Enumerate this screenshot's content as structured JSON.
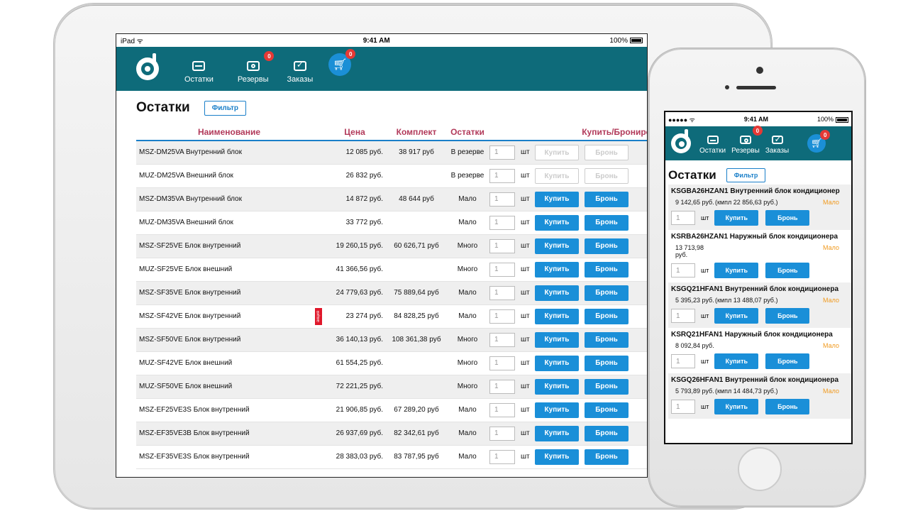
{
  "ipad": {
    "status": {
      "left": "iPad ᯤ",
      "time": "9:41 AM",
      "battery": "100%"
    },
    "nav": {
      "items": [
        {
          "label": "Остатки",
          "badge": ""
        },
        {
          "label": "Резервы",
          "badge": "0"
        },
        {
          "label": "Заказы",
          "badge": ""
        }
      ],
      "cart_badge": "0"
    },
    "title": "Остатки",
    "filter_label": "Фильтр",
    "table": {
      "headers": [
        "Наименование",
        "Цена",
        "Комплект",
        "Остатки",
        "",
        "Купить/Бронирo"
      ],
      "unit": "шт",
      "qty_default": "1",
      "buy_label": "Купить",
      "reserve_label": "Бронь",
      "promo_label": "акция",
      "rows": [
        {
          "name": "MSZ-DM25VA Внутренний блок",
          "price": "12 085 руб.",
          "kit": "38 917 руб",
          "status": "В резерве",
          "status_type": "reserve",
          "disabled": true,
          "promo": false
        },
        {
          "name": "MUZ-DM25VA Внешний блок",
          "price": "26 832 руб.",
          "kit": "",
          "status": "В резерве",
          "status_type": "reserve",
          "disabled": true,
          "promo": false
        },
        {
          "name": "MSZ-DM35VA Внутренний блок",
          "price": "14 872 руб.",
          "kit": "48 644 руб",
          "status": "Мало",
          "status_type": "low",
          "disabled": false,
          "promo": false
        },
        {
          "name": "MUZ-DM35VA Внешний блок",
          "price": "33 772 руб.",
          "kit": "",
          "status": "Мало",
          "status_type": "low",
          "disabled": false,
          "promo": false
        },
        {
          "name": "MSZ-SF25VE Блок внутренний",
          "price": "19 260,15 руб.",
          "kit": "60 626,71 руб",
          "status": "Много",
          "status_type": "many",
          "disabled": false,
          "promo": false
        },
        {
          "name": "MUZ-SF25VE Блок внешний",
          "price": "41 366,56 руб.",
          "kit": "",
          "status": "Много",
          "status_type": "many",
          "disabled": false,
          "promo": false
        },
        {
          "name": "MSZ-SF35VE Блок внутренний",
          "price": "24 779,63 руб.",
          "kit": "75 889,64 руб",
          "status": "Мало",
          "status_type": "low",
          "disabled": false,
          "promo": false
        },
        {
          "name": "MSZ-SF42VE Блок внутренний",
          "price": "23 274 руб.",
          "kit": "84 828,25 руб",
          "status": "Мало",
          "status_type": "low",
          "disabled": false,
          "promo": true
        },
        {
          "name": "MSZ-SF50VE Блок внутренний",
          "price": "36 140,13 руб.",
          "kit": "108 361,38 руб",
          "status": "Много",
          "status_type": "many",
          "disabled": false,
          "promo": false
        },
        {
          "name": "MUZ-SF42VE Блок внешний",
          "price": "61 554,25 руб.",
          "kit": "",
          "status": "Много",
          "status_type": "many",
          "disabled": false,
          "promo": false
        },
        {
          "name": "MUZ-SF50VE Блок внешний",
          "price": "72 221,25 руб.",
          "kit": "",
          "status": "Много",
          "status_type": "many",
          "disabled": false,
          "promo": false
        },
        {
          "name": "MSZ-EF25VE3S Блок внутренний",
          "price": "21 906,85 руб.",
          "kit": "67 289,20 руб",
          "status": "Мало",
          "status_type": "low",
          "disabled": false,
          "promo": false
        },
        {
          "name": "MSZ-EF35VE3B Блок внутренний",
          "price": "26 937,69 руб.",
          "kit": "82 342,61 руб",
          "status": "Мало",
          "status_type": "low",
          "disabled": false,
          "promo": false
        },
        {
          "name": "MSZ-EF35VE3S Блок внутренний",
          "price": "28 383,03 руб.",
          "kit": "83 787,95 руб",
          "status": "Мало",
          "status_type": "low",
          "disabled": false,
          "promo": false
        }
      ]
    }
  },
  "iphone": {
    "status": {
      "left": "●●●●● ᯤ",
      "time": "9:41 AM",
      "battery": "100%"
    },
    "nav": {
      "items": [
        {
          "label": "Остатки",
          "badge": ""
        },
        {
          "label": "Резервы",
          "badge": "0"
        },
        {
          "label": "Заказы",
          "badge": ""
        }
      ],
      "cart_badge": "0"
    },
    "title": "Остатки",
    "filter_label": "Фильтр",
    "unit": "шт",
    "qty_default": "1",
    "buy_label": "Купить",
    "reserve_label": "Бронь",
    "items": [
      {
        "name": "KSGBA26HZAN1 Внутренний блок кондиционер",
        "price": "9 142,65 руб.",
        "kit": "(кмпл 22 856,63 руб.)",
        "status": "Мало"
      },
      {
        "name": "KSRBA26HZAN1 Наружный блок кондиционера",
        "price": "13 713,98 руб.",
        "kit": "",
        "status": "Мало"
      },
      {
        "name": "KSGQ21HFAN1 Внутренний блок кондиционера",
        "price": "5 395,23 руб.",
        "kit": "(кмпл 13 488,07 руб.)",
        "status": "Мало"
      },
      {
        "name": "KSRQ21HFAN1 Наружный блок кондиционера",
        "price": "8 092,84 руб.",
        "kit": "",
        "status": "Мало"
      },
      {
        "name": "KSGQ26HFAN1 Внутренний блок кондиционера",
        "price": "5 793,89 руб.",
        "kit": "(кмпл 14 484,73 руб.)",
        "status": "Мало"
      }
    ]
  },
  "colors": {
    "appbar": "#0e6b7a",
    "accent": "#1a8fd8",
    "header_text": "#b23a5a",
    "reserve": "#c21ab7",
    "low": "#f09a1f",
    "many": "#1f9a2a",
    "badge": "#e53935"
  }
}
